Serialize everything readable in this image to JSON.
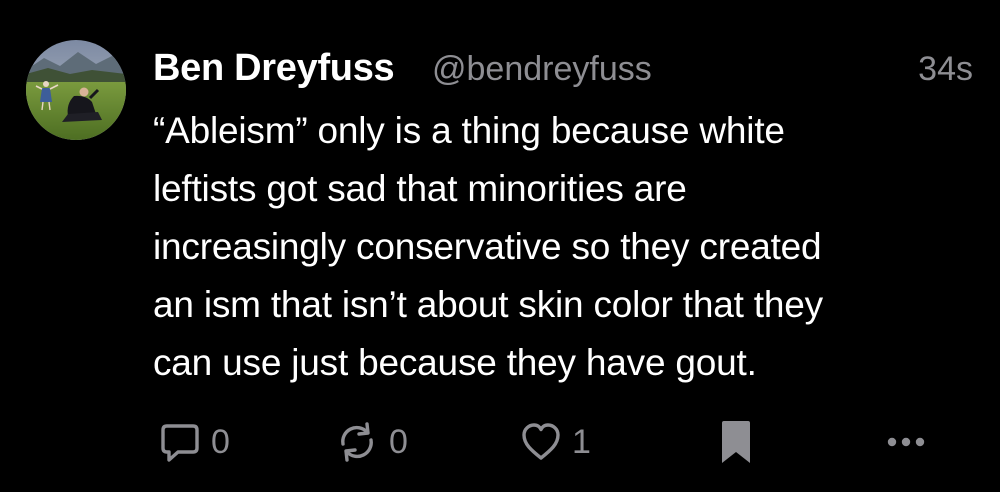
{
  "post": {
    "author": {
      "display_name": "Ben Dreyfuss",
      "handle": "@bendreyfuss"
    },
    "timestamp": "34s",
    "text_lines": [
      "“Ableism” only is a thing because white",
      "leftists got sad that minorities are",
      "increasingly conservative so they created",
      "an ism that isn’t about skin color that they",
      "can use just because they have gout."
    ],
    "actions": {
      "reply": {
        "icon": "reply-bubble-icon",
        "count": "0"
      },
      "repost": {
        "icon": "repost-icon",
        "count": "0"
      },
      "like": {
        "icon": "heart-icon",
        "count": "1"
      },
      "bookmark": {
        "icon": "bookmark-icon"
      },
      "more": {
        "icon": "more-ellipsis-icon"
      }
    }
  },
  "colors": {
    "background": "#000000",
    "primary_text": "#ffffff",
    "secondary_text": "#8e8e93"
  }
}
